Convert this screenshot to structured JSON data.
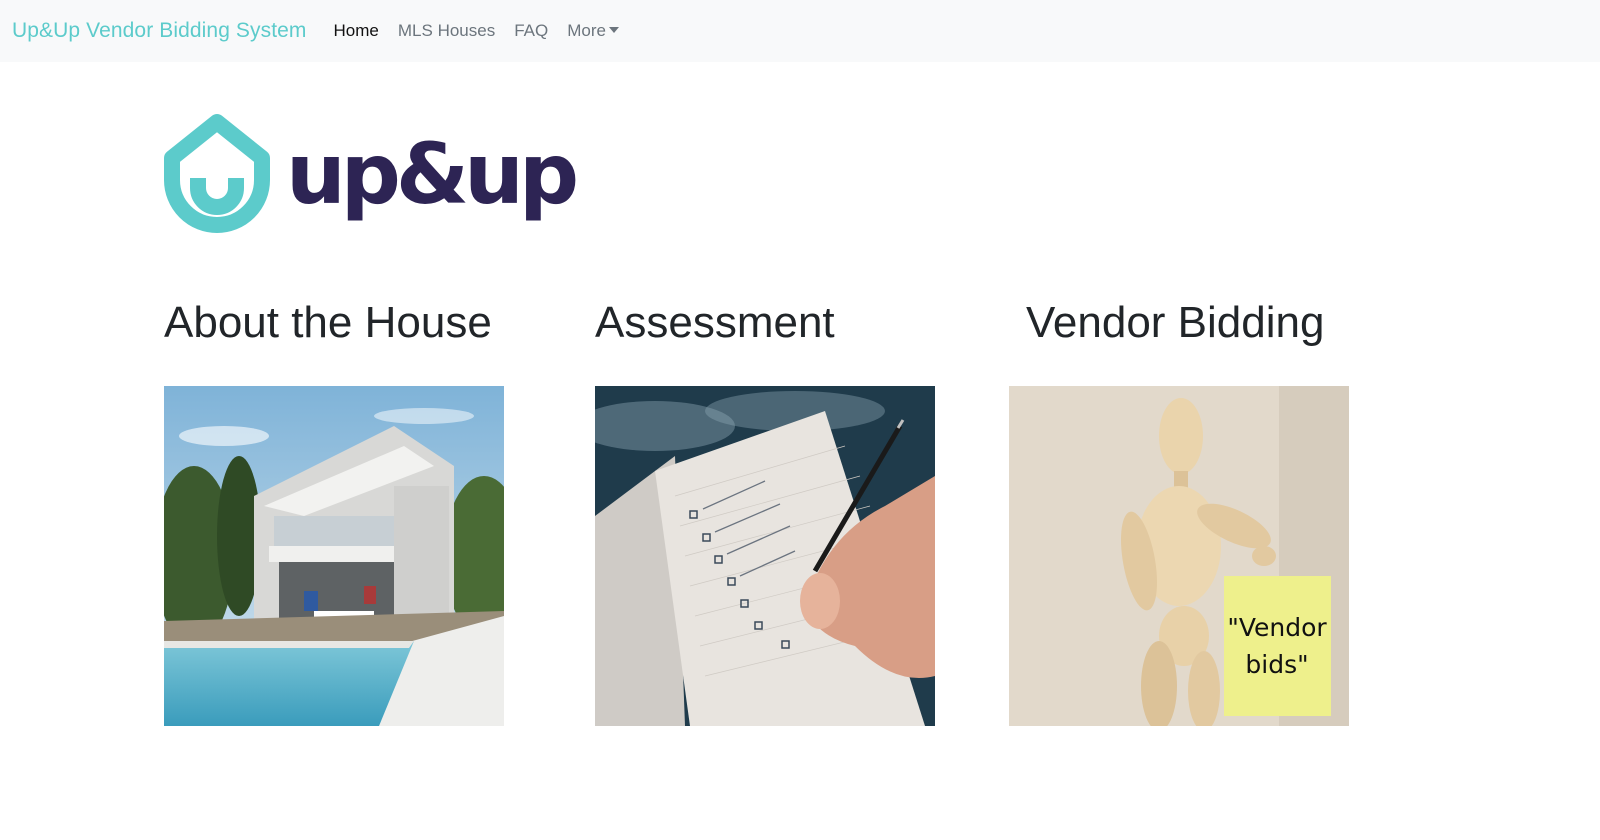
{
  "navbar": {
    "brand": "Up&Up Vendor Bidding System",
    "links": [
      {
        "label": "Home",
        "active": true
      },
      {
        "label": "MLS Houses",
        "active": false
      },
      {
        "label": "FAQ",
        "active": false
      },
      {
        "label": "More",
        "active": false,
        "dropdown": true
      }
    ]
  },
  "logo": {
    "text": "up&up",
    "icon": "house-shield-icon",
    "colors": {
      "icon": "#5ccbcb",
      "text": "#2d2454"
    }
  },
  "sections": [
    {
      "title": "About the House",
      "image": "modern-house-pool-image"
    },
    {
      "title": "Assessment",
      "image": "checklist-notebook-image"
    },
    {
      "title": "Vendor Bidding",
      "image": "wooden-mannequin-note-image",
      "note_text_line1": "\"Vendor",
      "note_text_line2": "bids\""
    }
  ],
  "colors": {
    "brand": "#5ccbcb",
    "navbar_bg": "#f8f9fa"
  }
}
